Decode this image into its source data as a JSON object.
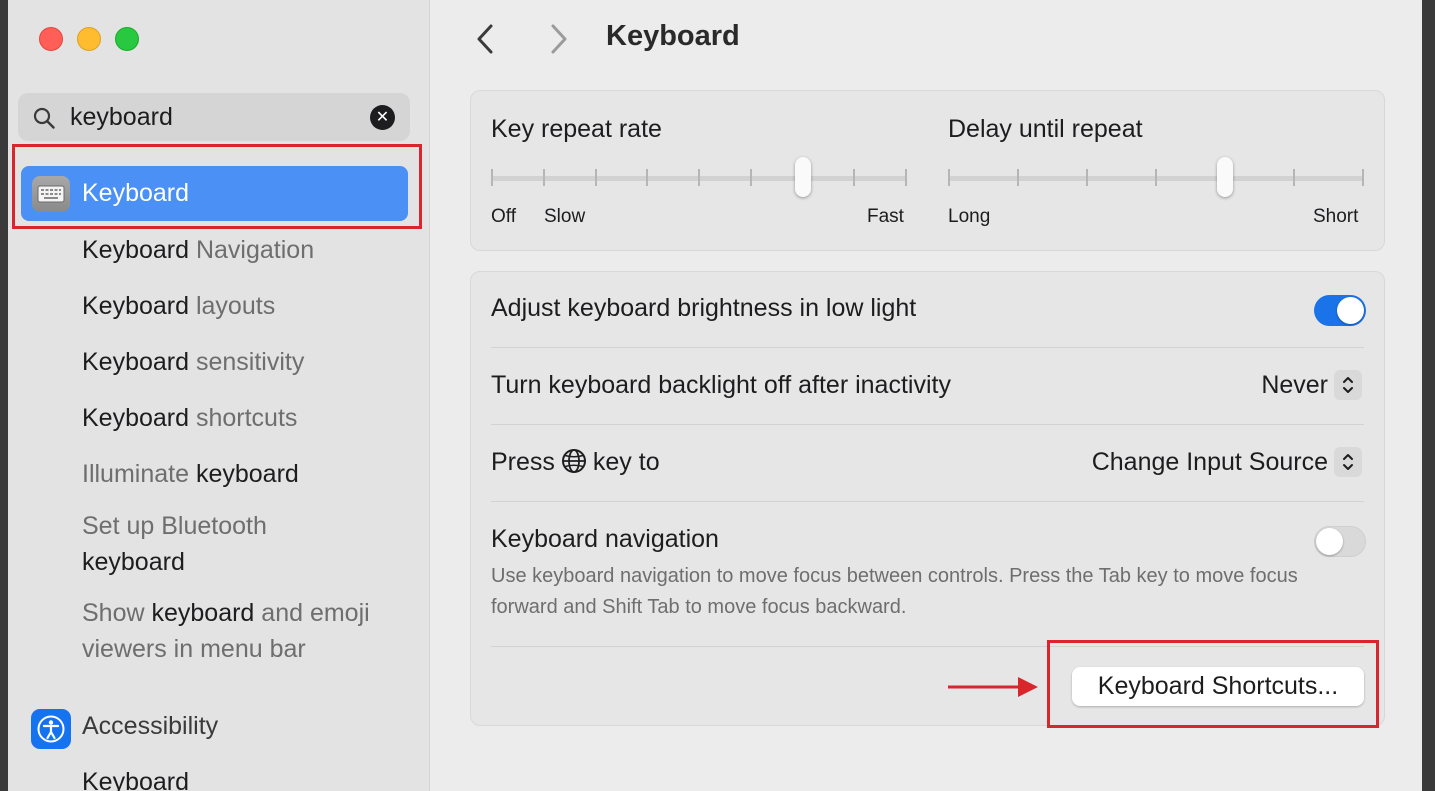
{
  "window": {
    "traffic_lights": {
      "close_color": "#ff5f57",
      "minimize_color": "#febc2e",
      "maximize_color": "#28c840"
    }
  },
  "sidebar": {
    "search": {
      "value": "keyboard",
      "clear_icon": "xmark-circle-icon"
    },
    "selected_item": {
      "label": "Keyboard",
      "icon": "keyboard-icon",
      "accent": "#4a90f5"
    },
    "results": [
      {
        "pre": "Keyboard",
        "post": " Navigation"
      },
      {
        "pre": "Keyboard",
        "post": " layouts"
      },
      {
        "pre": "Keyboard",
        "post": " sensitivity"
      },
      {
        "pre": "Keyboard",
        "post": " shortcuts"
      },
      {
        "pre": "Illuminate ",
        "post": "keyboard"
      }
    ],
    "result_bluetooth": {
      "line1": "Set up Bluetooth",
      "line2": "keyboard"
    },
    "result_emoji": {
      "line1_pre": "Show ",
      "line1_bold": "keyboard",
      "line1_post": " and emoji",
      "line2": "viewers in menu bar"
    },
    "accessibility": {
      "label": "Accessibility",
      "icon": "accessibility-icon",
      "sub_label": "Keyboard"
    }
  },
  "main": {
    "title": "Keyboard",
    "nav": {
      "back_icon": "chevron-left-icon",
      "forward_icon": "chevron-right-icon"
    },
    "key_repeat": {
      "title": "Key repeat rate",
      "labels": {
        "left1": "Off",
        "left2": "Slow",
        "right": "Fast"
      },
      "value_step": 6,
      "steps": 8
    },
    "delay_repeat": {
      "title": "Delay until repeat",
      "labels": {
        "left": "Long",
        "right": "Short"
      },
      "value_step": 4,
      "steps": 6
    },
    "brightness": {
      "label": "Adjust keyboard brightness in low light",
      "on": true
    },
    "backlight": {
      "label": "Turn keyboard backlight off after inactivity",
      "value": "Never"
    },
    "globe_key": {
      "label_pre": "Press",
      "label_post": "key to",
      "value": "Change Input Source",
      "icon": "globe-icon"
    },
    "keyboard_navigation": {
      "label": "Keyboard navigation",
      "on": false,
      "description": "Use keyboard navigation to move focus between controls. Press the Tab key to move focus forward and Shift Tab to move focus backward."
    },
    "shortcuts_button": {
      "label": "Keyboard Shortcuts..."
    }
  },
  "annotations": {
    "highlight_color": "#d8262c"
  }
}
